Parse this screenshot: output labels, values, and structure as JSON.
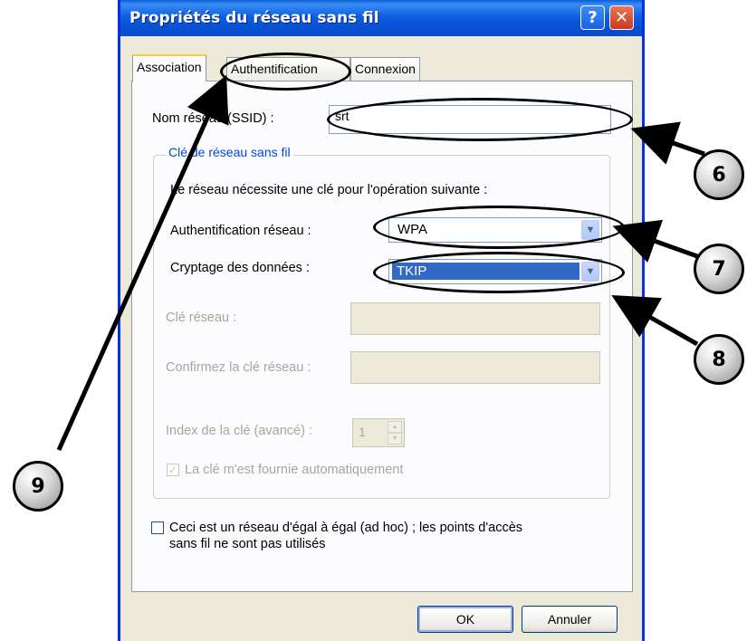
{
  "window": {
    "title": "Propriétés du réseau sans fil",
    "help_glyph": "?",
    "close_glyph": "✕"
  },
  "tabs": [
    {
      "label": "Association",
      "active": true
    },
    {
      "label": "Authentification",
      "active": false
    },
    {
      "label": "Connexion",
      "active": false
    }
  ],
  "ssid": {
    "label": "Nom réseau (SSID) :",
    "value": "srt"
  },
  "key_group": {
    "title": "Clé de réseau sans fil",
    "intro": "Le réseau nécessite une clé pour l'opération suivante :",
    "auth_label": "Authentification réseau :",
    "auth_value": "WPA",
    "encryption_label": "Cryptage des données :",
    "encryption_value": "TKIP",
    "key_label": "Clé réseau :",
    "confirm_label": "Confirmez la clé réseau :",
    "index_label": "Index de la clé (avancé) :",
    "index_value": "1",
    "auto_key_label": "La clé m'est fournie automatiquement",
    "auto_key_checked": true
  },
  "adhoc": {
    "label_line1": "Ceci est un réseau d'égal à égal (ad hoc) ; les points d'accès",
    "label_line2": "sans fil ne sont pas utilisés",
    "checked": false
  },
  "buttons": {
    "ok": "OK",
    "cancel": "Annuler"
  },
  "annotations": {
    "n6": "6",
    "n7": "7",
    "n8": "8",
    "n9": "9"
  },
  "colors": {
    "title_bar": "#0a56d8",
    "dialog_bg": "#ece9d8",
    "group_title": "#0046d5",
    "selection": "#316ac5"
  }
}
